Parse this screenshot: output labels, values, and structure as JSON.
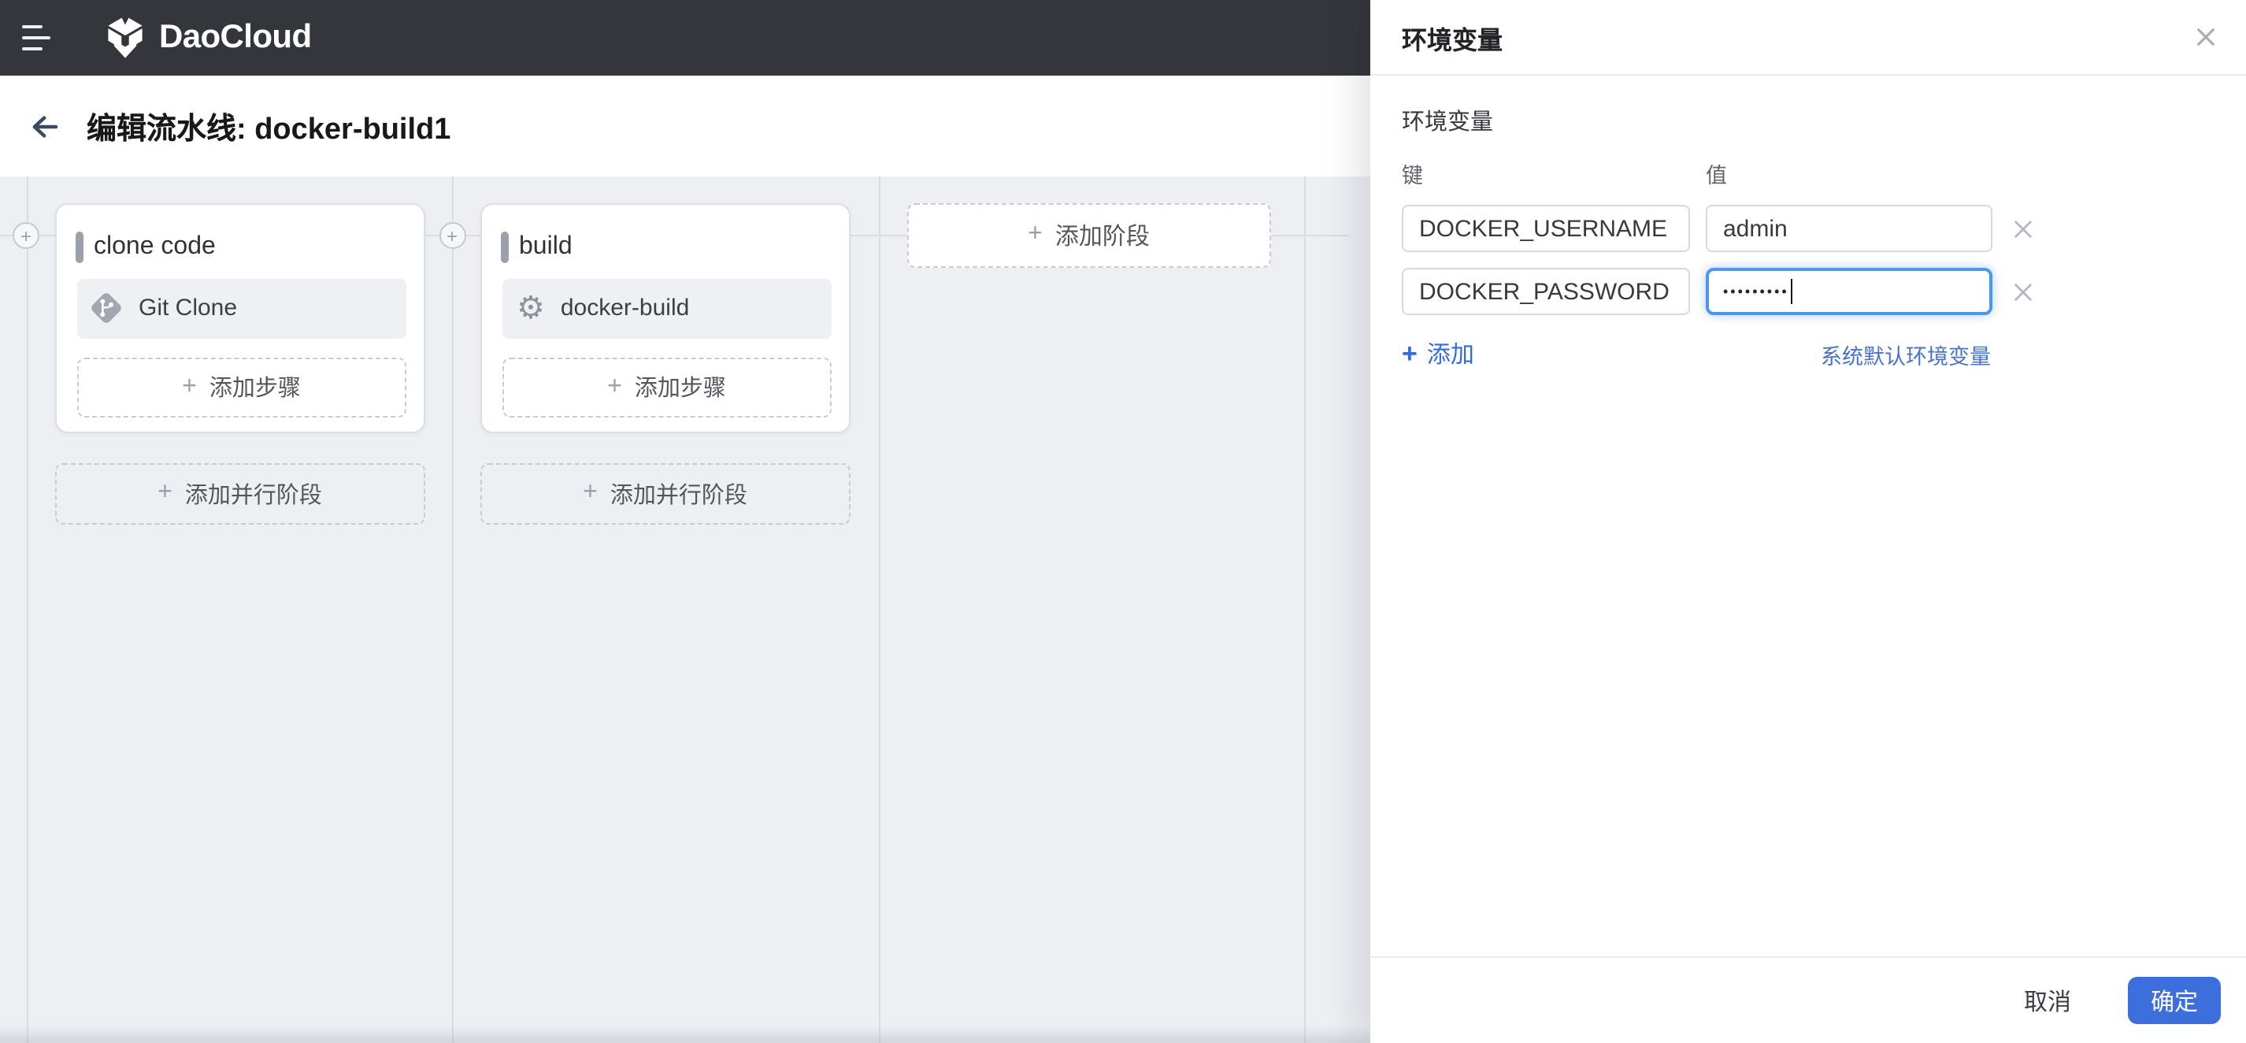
{
  "brand": {
    "name": "DaoCloud"
  },
  "page": {
    "title": "编辑流水线: docker-build1"
  },
  "icons": {
    "plus": "+",
    "gear": "⚙"
  },
  "pipeline": {
    "stages": [
      {
        "name": "clone code",
        "step": "Git Clone"
      },
      {
        "name": "build",
        "step": "docker-build"
      }
    ],
    "add_step": "添加步骤",
    "add_parallel_stage": "添加并行阶段",
    "add_stage": "添加阶段"
  },
  "panel": {
    "title": "环境变量",
    "section": "环境变量",
    "key_header": "键",
    "value_header": "值",
    "rows": [
      {
        "key": "DOCKER_USERNAME",
        "value": "admin"
      },
      {
        "key": "DOCKER_PASSWORD",
        "value": "•••••••••"
      }
    ],
    "add": "添加",
    "system_defaults": "系统默认环境变量",
    "cancel": "取消",
    "confirm": "确定"
  },
  "colors": {
    "header_bg": "#34363c",
    "primary_blue": "#3c6fdb",
    "link_blue": "#2e6ce2",
    "focus_blue": "#4b97ea",
    "canvas_bg": "#edeff3"
  }
}
